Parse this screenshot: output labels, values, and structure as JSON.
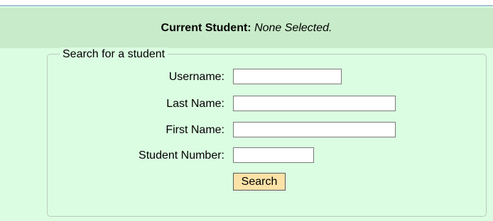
{
  "status": {
    "label": "Current Student:",
    "value": "None Selected."
  },
  "search_form": {
    "legend": "Search for a student",
    "fields": [
      {
        "label": "Username:",
        "value": "",
        "placeholder": ""
      },
      {
        "label": "Last Name:",
        "value": "",
        "placeholder": ""
      },
      {
        "label": "First Name:",
        "value": "",
        "placeholder": ""
      },
      {
        "label": "Student Number:",
        "value": "",
        "placeholder": ""
      }
    ],
    "search_button_label": "Search"
  },
  "colors": {
    "page_background": "#dbfde1",
    "status_bar_background": "#c8ebc9",
    "top_rule": "#a7c4d6",
    "button_background": "#fde2a8"
  }
}
